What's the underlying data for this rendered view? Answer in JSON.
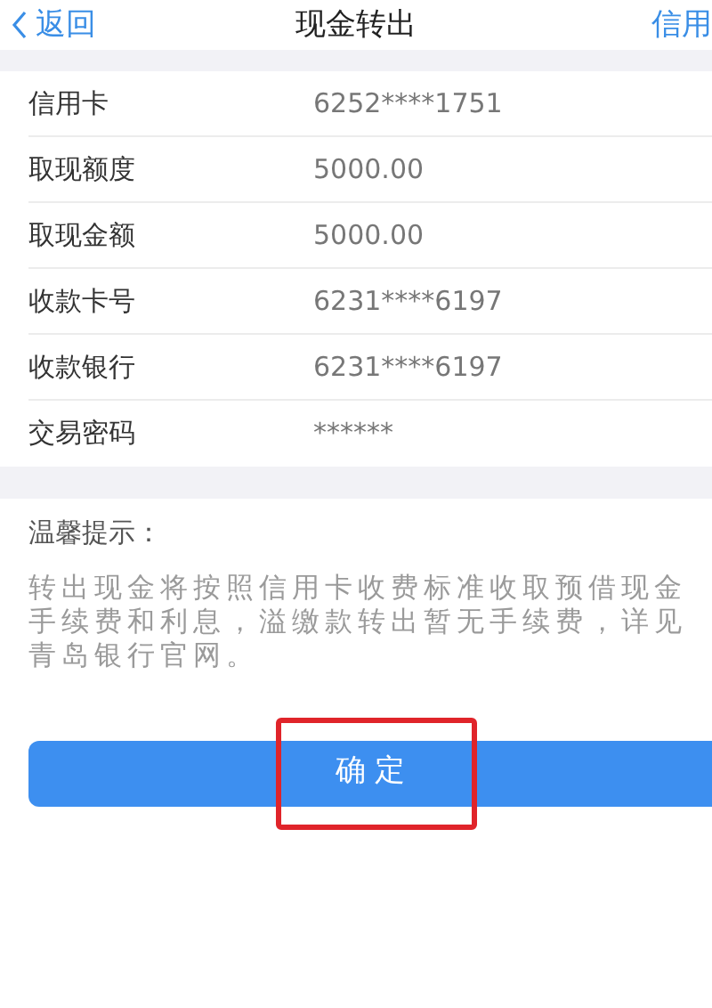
{
  "nav_bar": {
    "back": "返回",
    "title": "现金转出",
    "right_link": "信用"
  },
  "rows": [
    {
      "label": "信用卡",
      "value": "6252****1751"
    },
    {
      "label": "取现额度",
      "value": "5000.00"
    },
    {
      "label": "取现金额",
      "value": "5000.00"
    },
    {
      "label": "收款卡号",
      "value": "6231****6197"
    },
    {
      "label": "收款银行",
      "value": "6231****6197"
    },
    {
      "label": "交易密码",
      "value": "******"
    }
  ],
  "notice": {
    "title": "温馨提示：",
    "text": "转出现金将按照信用卡收费标准收取预借现金手续费和利息，溢缴款转出暂无手续费，详见青岛银行官网。"
  },
  "confirm_button": {
    "label": "确 定",
    "highlighted": true
  }
}
